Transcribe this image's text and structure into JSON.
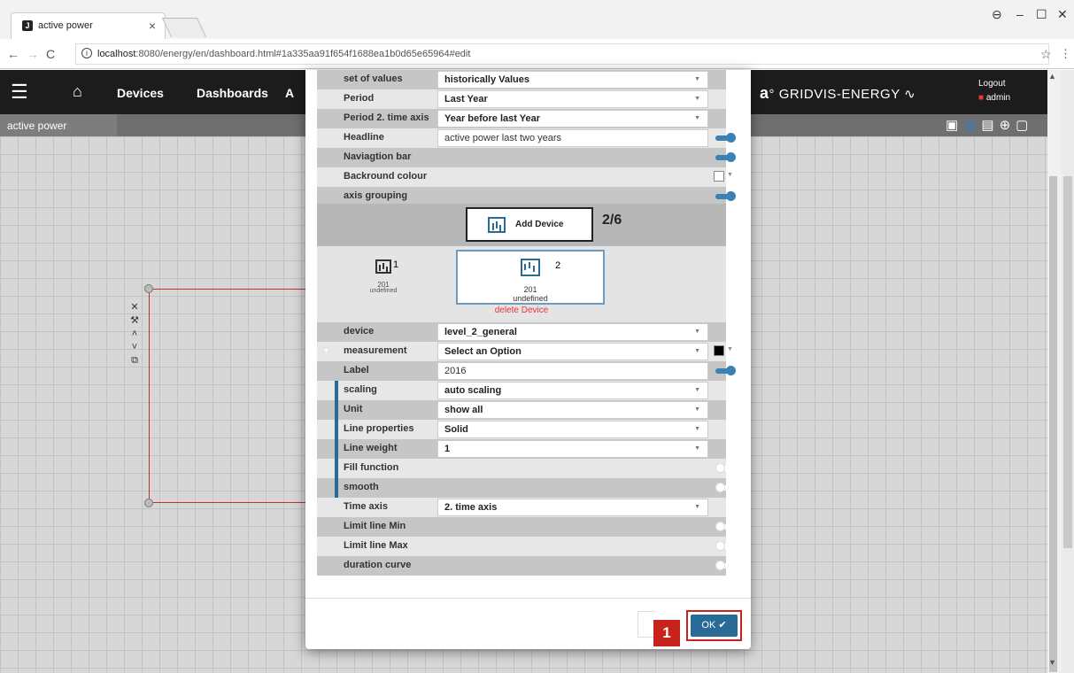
{
  "browser": {
    "tab_title": "active power",
    "tab_favicon": "J",
    "url_host": "localhost",
    "url_rest": ":8080/energy/en/dashboard.html#1a335aa91f654f1688ea1b0d65e65964#edit"
  },
  "app": {
    "nav": [
      "Devices",
      "Dashboards",
      "A"
    ],
    "brand": "GRIDVIS-ENERGY",
    "logout": "Logout",
    "user": "admin",
    "breadcrumb": "active power"
  },
  "form": {
    "rows_top": [
      {
        "label": "set of values",
        "value": "historically Values",
        "type": "select"
      },
      {
        "label": "Period",
        "value": "Last Year",
        "type": "select"
      },
      {
        "label": "Period 2. time axis",
        "value": "Year before last Year",
        "type": "select"
      },
      {
        "label": "Headline",
        "value": "active power last two years",
        "type": "text",
        "toggle": true
      },
      {
        "label": "Naviagtion bar",
        "value": "",
        "type": "none",
        "toggle": true
      },
      {
        "label": "Backround colour",
        "value": "",
        "type": "none",
        "color": "#ffffff"
      },
      {
        "label": "axis grouping",
        "value": "",
        "type": "none",
        "toggle": true
      }
    ],
    "add_device_label": "Add Device",
    "device_count": "2/6",
    "devices": [
      {
        "num": "1",
        "id": "201",
        "status": "undefined"
      },
      {
        "num": "2",
        "id": "201",
        "status": "undefined"
      }
    ],
    "delete_device": "delete Device",
    "rows_bottom": [
      {
        "label": "device",
        "value": "level_2_general",
        "type": "select"
      },
      {
        "label": "measurement",
        "value": "Select an Option",
        "type": "select",
        "color": "#000000"
      },
      {
        "label": "Label",
        "value": "2016",
        "type": "text",
        "toggle": true
      },
      {
        "label": "scaling",
        "value": "auto scaling",
        "type": "select"
      },
      {
        "label": "Unit",
        "value": "show all",
        "type": "select"
      },
      {
        "label": "Line properties",
        "value": "Solid",
        "type": "select"
      },
      {
        "label": "Line weight",
        "value": "1",
        "type": "select"
      },
      {
        "label": "Fill function",
        "value": "",
        "type": "none",
        "toggle": false
      },
      {
        "label": "smooth",
        "value": "",
        "type": "none",
        "toggle": false
      },
      {
        "label": "Time axis",
        "value": "2. time axis",
        "type": "select"
      },
      {
        "label": "Limit line Min",
        "value": "",
        "type": "none",
        "toggle": false
      },
      {
        "label": "Limit line Max",
        "value": "",
        "type": "none",
        "toggle": false
      },
      {
        "label": "duration curve",
        "value": "",
        "type": "none",
        "toggle": false
      }
    ]
  },
  "footer": {
    "step_badge": "1",
    "ok_label": "OK ✔"
  },
  "colors": {
    "accent": "#2a6a96",
    "highlight": "#c8221d"
  }
}
